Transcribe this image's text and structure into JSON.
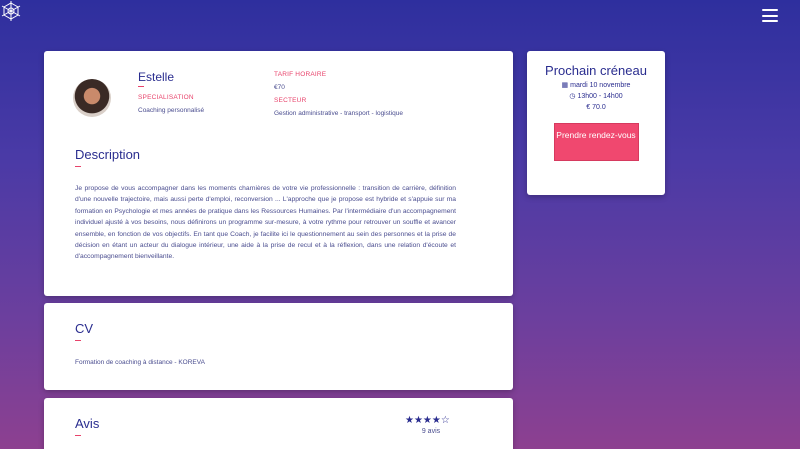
{
  "nav": {
    "logo_icon": "snowflake-icon",
    "menu_icon": "hamburger-icon"
  },
  "profile": {
    "name": "Estelle",
    "specialisation_label": "SPECIALISATION",
    "specialisation_value": "Coaching personnalisé",
    "tarif_label": "TARIF HORAIRE",
    "tarif_value": "€70",
    "secteur_label": "SECTEUR",
    "secteur_value": "Gestion administrative - transport - logistique"
  },
  "description": {
    "title": "Description",
    "text": "Je propose de vous accompagner dans les moments charnières de votre vie professionnelle : transition de carrière, définition d'une nouvelle trajectoire, mais aussi perte d'emploi, reconversion ... L'approche que je propose est hybride et s'appuie sur ma formation en Psychologie et mes années de pratique dans les Ressources Humaines. Par l'intermédiaire d'un accompagnement individuel ajusté à vos besoins, nous définirons un programme sur-mesure, à votre rythme pour retrouver un souffle et avancer ensemble, en fonction de vos objectifs. En tant que Coach, je facilite ici le questionnement au sein des personnes et la prise de décision en étant un acteur du dialogue intérieur, une aide à la prise de recul et à la réflexion, dans une relation d'écoute et d'accompagnement bienveillante."
  },
  "cv": {
    "title": "CV",
    "text": "Formation de coaching à distance - KOREVA"
  },
  "avis": {
    "title": "Avis",
    "rating": 4,
    "max_rating": 5,
    "stars": "★★★★☆",
    "count": "9 avis"
  },
  "slot": {
    "title": "Prochain créneau",
    "date": "mardi 10 novembre",
    "time": "13h00 - 14h00",
    "price": "€ 70.0",
    "button_label": "Prendre rendez-vous",
    "calendar_icon": "calendar-icon",
    "clock_icon": "clock-icon",
    "accent_color": "#f0486f"
  }
}
